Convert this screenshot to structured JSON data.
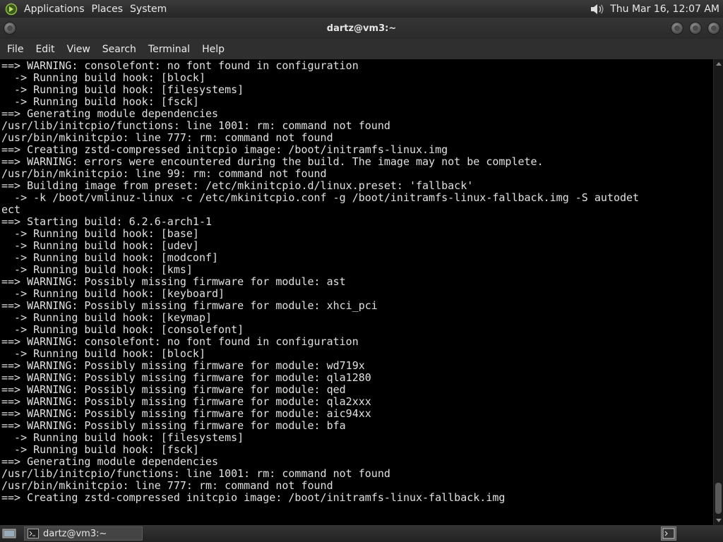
{
  "top_panel": {
    "menus": [
      "Applications",
      "Places",
      "System"
    ],
    "clock": "Thu Mar 16, 12:07 AM"
  },
  "window": {
    "title": "dartz@vm3:~",
    "menu": [
      "File",
      "Edit",
      "View",
      "Search",
      "Terminal",
      "Help"
    ]
  },
  "terminal": {
    "lines": [
      "==> WARNING: consolefont: no font found in configuration",
      "  -> Running build hook: [block]",
      "  -> Running build hook: [filesystems]",
      "  -> Running build hook: [fsck]",
      "==> Generating module dependencies",
      "/usr/lib/initcpio/functions: line 1001: rm: command not found",
      "/usr/bin/mkinitcpio: line 777: rm: command not found",
      "==> Creating zstd-compressed initcpio image: /boot/initramfs-linux.img",
      "==> WARNING: errors were encountered during the build. The image may not be complete.",
      "/usr/bin/mkinitcpio: line 99: rm: command not found",
      "==> Building image from preset: /etc/mkinitcpio.d/linux.preset: 'fallback'",
      "  -> -k /boot/vmlinuz-linux -c /etc/mkinitcpio.conf -g /boot/initramfs-linux-fallback.img -S autodet",
      "ect",
      "==> Starting build: 6.2.6-arch1-1",
      "  -> Running build hook: [base]",
      "  -> Running build hook: [udev]",
      "  -> Running build hook: [modconf]",
      "  -> Running build hook: [kms]",
      "==> WARNING: Possibly missing firmware for module: ast",
      "  -> Running build hook: [keyboard]",
      "==> WARNING: Possibly missing firmware for module: xhci_pci",
      "  -> Running build hook: [keymap]",
      "  -> Running build hook: [consolefont]",
      "==> WARNING: consolefont: no font found in configuration",
      "  -> Running build hook: [block]",
      "==> WARNING: Possibly missing firmware for module: wd719x",
      "==> WARNING: Possibly missing firmware for module: qla1280",
      "==> WARNING: Possibly missing firmware for module: qed",
      "==> WARNING: Possibly missing firmware for module: qla2xxx",
      "==> WARNING: Possibly missing firmware for module: aic94xx",
      "==> WARNING: Possibly missing firmware for module: bfa",
      "  -> Running build hook: [filesystems]",
      "  -> Running build hook: [fsck]",
      "==> Generating module dependencies",
      "/usr/lib/initcpio/functions: line 1001: rm: command not found",
      "/usr/bin/mkinitcpio: line 777: rm: command not found",
      "==> Creating zstd-compressed initcpio image: /boot/initramfs-linux-fallback.img"
    ]
  },
  "taskbar": {
    "task_label": "dartz@vm3:~"
  }
}
